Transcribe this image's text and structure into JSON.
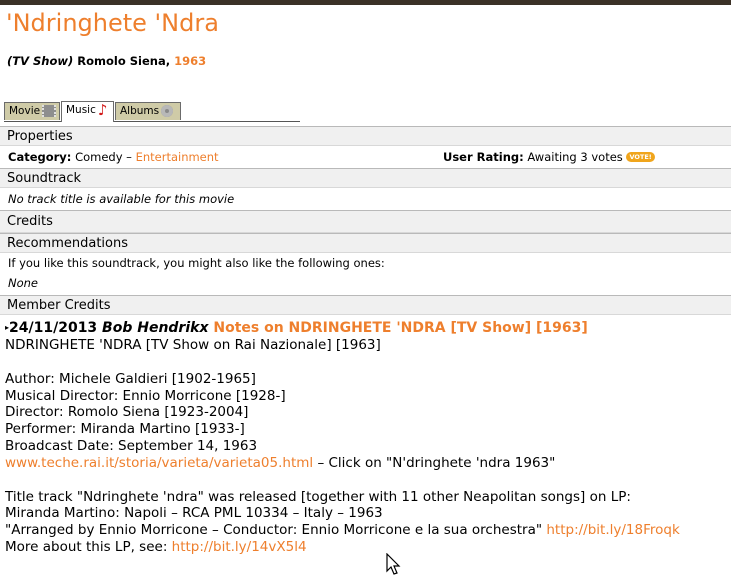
{
  "page": {
    "title": "'Ndringhete 'Ndra",
    "type": "(TV Show)",
    "director": "Romolo Siena,",
    "year": "1963"
  },
  "tabs": [
    {
      "label": "Movie",
      "icon": "film-icon"
    },
    {
      "label": "Music",
      "icon": "music-note-icon",
      "active": true
    },
    {
      "label": "Albums",
      "icon": "disc-icon"
    }
  ],
  "properties": {
    "header": "Properties",
    "category_label": "Category:",
    "category_value": "Comedy",
    "category_sep": "–",
    "category_link": "Entertainment",
    "rating_label": "User Rating:",
    "rating_value": "Awaiting 3 votes",
    "vote_badge": "VOTE!"
  },
  "soundtrack": {
    "header": "Soundtrack",
    "empty_text": "No track title is available for this movie"
  },
  "credits": {
    "header": "Credits"
  },
  "recommendations": {
    "header": "Recommendations",
    "intro": "If you like this soundtrack, you might also like the following ones:",
    "none": "None"
  },
  "member_credits": {
    "header": "Member Credits",
    "date": "24/11/2013",
    "author": "Bob Hendrikx",
    "notes_link": "Notes on NDRINGHETE 'NDRA [TV Show] [1963]",
    "lines": {
      "l1": "NDRINGHETE 'NDRA [TV Show on Rai Nazionale] [1963]",
      "l2": "Author: Michele Galdieri [1902-1965]",
      "l3": "Musical Director: Ennio Morricone [1928-]",
      "l4": "Director: Romolo Siena [1923-2004]",
      "l5": "Performer: Miranda Martino [1933-]",
      "l6": "Broadcast Date: September 14, 1963",
      "l7_link": "www.teche.rai.it/storia/varieta/varieta05.html",
      "l7_text": " – Click on \"N'dringhete 'ndra 1963\"",
      "l8": "Title track \"Ndringhete 'ndra\" was released [together with 11 other Neapolitan songs] on LP:",
      "l9": "Miranda Martino: Napoli – RCA PML 10334 – Italy – 1963",
      "l10_text": "\"Arranged by Ennio Morricone – Conductor: Ennio Morricone e la sua orchestra\" ",
      "l10_link": "http://bit.ly/18Froqk",
      "l11_text": "More about this LP, see: ",
      "l11_link": "http://bit.ly/14vX5l4"
    }
  },
  "colors": {
    "accent": "#ee7f2d",
    "section_bg": "#f0f0f0",
    "tab_bg": "#cfcba7",
    "top_bar": "#3b3127"
  }
}
